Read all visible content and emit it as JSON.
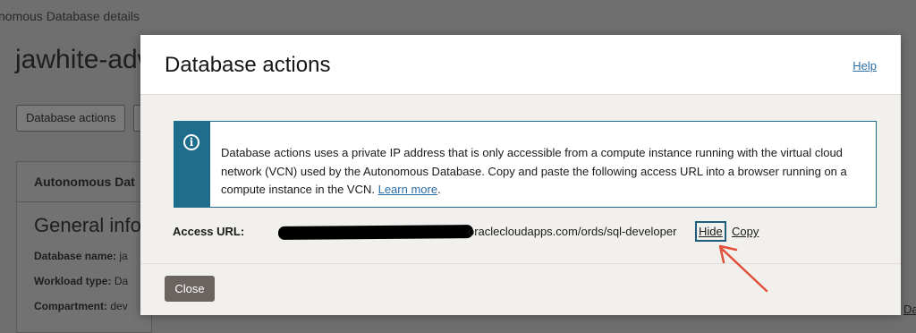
{
  "background": {
    "breadcrumb": "nomous Database details",
    "title": "jawhite-adw",
    "action_button": "Database actions",
    "panel_heading": "Autonomous Dat",
    "section_title": "General info",
    "fields": [
      {
        "label": "Database name:",
        "value": "ja"
      },
      {
        "label": "Workload type:",
        "value": "Da"
      },
      {
        "label": "Compartment:",
        "value": "dev"
      }
    ],
    "right_link": "Da"
  },
  "dialog": {
    "title": "Database actions",
    "help_label": "Help",
    "info": {
      "icon": "info-icon",
      "text": "Database actions uses a private IP address that is only accessible from a compute instance running with the virtual cloud network (VCN) used by the Autonomous Database. Copy and paste the following access URL into a browser running on a compute instance in the VCN. ",
      "link": "Learn more",
      "after_link": "."
    },
    "access_url": {
      "label": "Access URL:",
      "visible_part": "oraclecloudapps.com/ords/sql-developer",
      "hide_label": "Hide",
      "copy_label": "Copy"
    },
    "close_label": "Close"
  },
  "colors": {
    "accent": "#1f6d8d",
    "link": "#2b6ea6",
    "arrow": "#e0503a"
  }
}
